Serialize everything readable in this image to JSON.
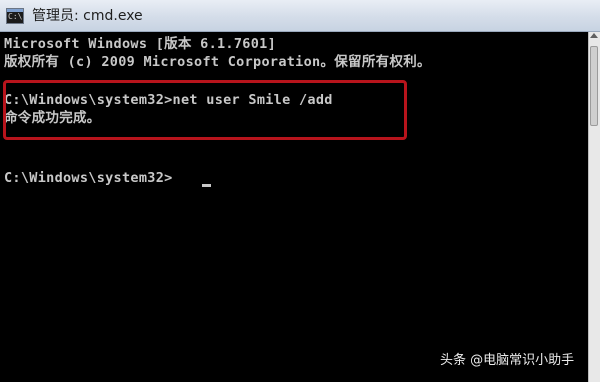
{
  "window": {
    "title": "管理员: cmd.exe",
    "icon": "cmd-console-icon"
  },
  "console": {
    "lines": [
      "Microsoft Windows [版本 6.1.7601]",
      "版权所有 (c) 2009 Microsoft Corporation。保留所有权利。",
      "",
      "C:\\Windows\\system32>net user Smile /add",
      "命令成功完成。",
      "",
      "",
      "C:\\Windows\\system32>"
    ]
  },
  "colors": {
    "console_bg": "#000000",
    "console_fg": "#c8c8c8",
    "highlight_border": "#b8141c"
  },
  "watermark": {
    "text": "头条 @电脑常识小助手"
  }
}
